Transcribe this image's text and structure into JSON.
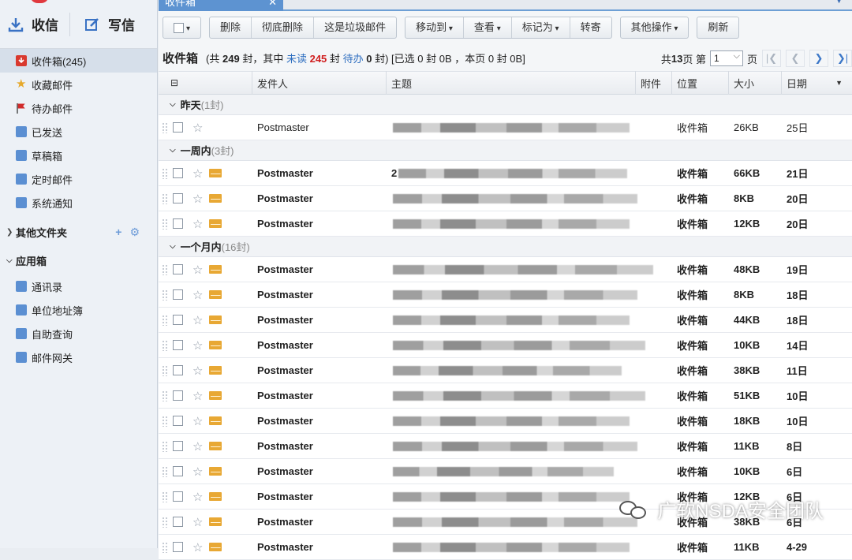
{
  "sidebar": {
    "receive_label": "收信",
    "write_label": "写信",
    "folders": [
      {
        "label": "收件箱(245)",
        "icon": "inbox-icon",
        "active": true
      },
      {
        "label": "收藏邮件",
        "icon": "star-icon"
      },
      {
        "label": "待办邮件",
        "icon": "flag-icon"
      },
      {
        "label": "已发送",
        "icon": "folder-icon"
      },
      {
        "label": "草稿箱",
        "icon": "folder-icon"
      },
      {
        "label": "定时邮件",
        "icon": "folder-icon"
      },
      {
        "label": "系统通知",
        "icon": "folder-icon"
      }
    ],
    "other_folders_label": "其他文件夹",
    "apps_label": "应用箱",
    "apps": [
      {
        "label": "通讯录"
      },
      {
        "label": "单位地址簿"
      },
      {
        "label": "自助查询"
      },
      {
        "label": "邮件网关"
      }
    ]
  },
  "tab": {
    "label": "收件箱"
  },
  "toolbar": {
    "delete": "删除",
    "perm_delete": "彻底删除",
    "spam": "这是垃圾邮件",
    "move_to": "移动到",
    "view": "查看",
    "mark_as": "标记为",
    "forward": "转寄",
    "other_ops": "其他操作",
    "refresh": "刷新"
  },
  "header": {
    "title": "收件箱",
    "total_pre": "(共",
    "total": "249",
    "mid1": "封，其中",
    "unread_label": "未读",
    "unread": "245",
    "mid2": "封",
    "todo_label": "待办",
    "todo": "0",
    "mid3": "封)",
    "selection": "[已选 0 封 0B ，本页 0 封 0B]"
  },
  "pager": {
    "total_pages_pre": "共",
    "total_pages": "13",
    "total_pages_post": "页 第",
    "current": "1",
    "page_suffix": "页"
  },
  "columns": {
    "from": "发件人",
    "subject": "主题",
    "attachment": "附件",
    "location": "位置",
    "size": "大小",
    "date": "日期"
  },
  "groups": [
    {
      "label": "昨天",
      "count": "(1封)",
      "rows": [
        {
          "from": "Postmaster",
          "subject_prefix": "",
          "location": "收件箱",
          "size": "26KB",
          "date": "25日",
          "unread": false
        }
      ]
    },
    {
      "label": "一周内",
      "count": "(3封)",
      "rows": [
        {
          "from": "Postmaster",
          "subject_prefix": "2",
          "location": "收件箱",
          "size": "66KB",
          "date": "21日",
          "unread": true
        },
        {
          "from": "Postmaster",
          "subject_prefix": "",
          "location": "收件箱",
          "size": "8KB",
          "date": "20日",
          "unread": true
        },
        {
          "from": "Postmaster",
          "subject_prefix": "",
          "location": "收件箱",
          "size": "12KB",
          "date": "20日",
          "unread": true
        }
      ]
    },
    {
      "label": "一个月内",
      "count": "(16封)",
      "rows": [
        {
          "from": "Postmaster",
          "subject_prefix": "",
          "location": "收件箱",
          "size": "48KB",
          "date": "19日",
          "unread": true
        },
        {
          "from": "Postmaster",
          "subject_prefix": "",
          "location": "收件箱",
          "size": "8KB",
          "date": "18日",
          "unread": true
        },
        {
          "from": "Postmaster",
          "subject_prefix": "",
          "location": "收件箱",
          "size": "44KB",
          "date": "18日",
          "unread": true
        },
        {
          "from": "Postmaster",
          "subject_prefix": "",
          "location": "收件箱",
          "size": "10KB",
          "date": "14日",
          "unread": true
        },
        {
          "from": "Postmaster",
          "subject_prefix": "",
          "location": "收件箱",
          "size": "38KB",
          "date": "11日",
          "unread": true
        },
        {
          "from": "Postmaster",
          "subject_prefix": "",
          "location": "收件箱",
          "size": "51KB",
          "date": "10日",
          "unread": true
        },
        {
          "from": "Postmaster",
          "subject_prefix": "",
          "location": "收件箱",
          "size": "18KB",
          "date": "10日",
          "unread": true
        },
        {
          "from": "Postmaster",
          "subject_prefix": "",
          "location": "收件箱",
          "size": "11KB",
          "date": "8日",
          "unread": true
        },
        {
          "from": "Postmaster",
          "subject_prefix": "",
          "location": "收件箱",
          "size": "10KB",
          "date": "6日",
          "unread": true
        },
        {
          "from": "Postmaster",
          "subject_prefix": "",
          "location": "收件箱",
          "size": "12KB",
          "date": "6日",
          "unread": true
        },
        {
          "from": "Postmaster",
          "subject_prefix": "",
          "location": "收件箱",
          "size": "38KB",
          "date": "6日",
          "unread": true
        },
        {
          "from": "Postmaster",
          "subject_prefix": "",
          "location": "收件箱",
          "size": "11KB",
          "date": "4-29",
          "unread": true
        }
      ]
    }
  ],
  "watermark": "广软NSDA安全团队",
  "colors": {
    "accent": "#5d93d1",
    "unread_count": "#d02020",
    "envelope": "#e8a834"
  }
}
